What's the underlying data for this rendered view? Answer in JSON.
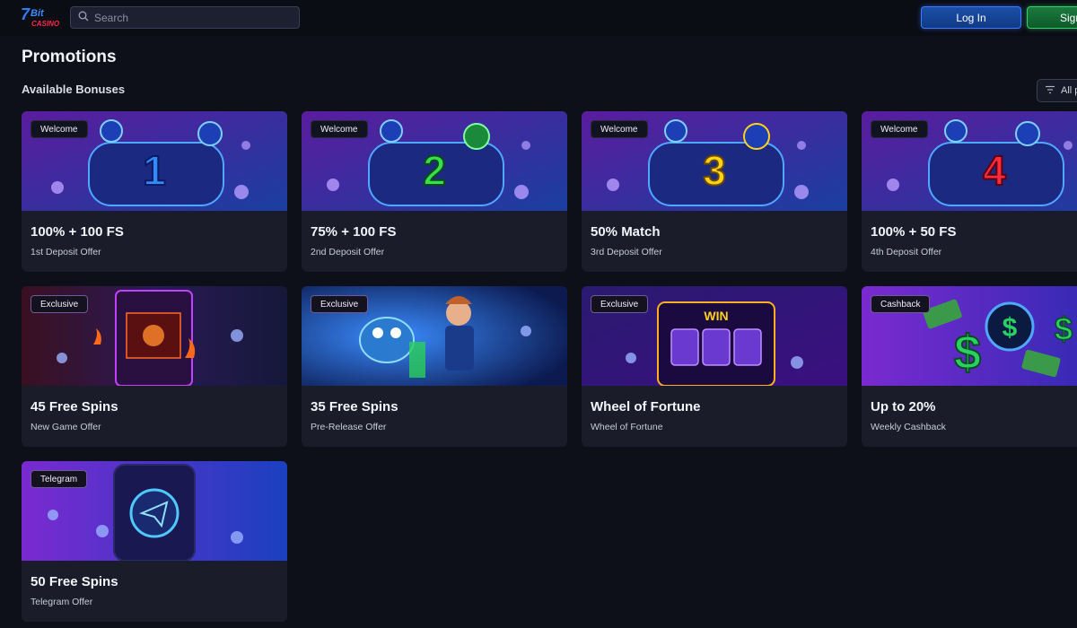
{
  "header": {
    "logo_text": "7Bit Casino",
    "search_placeholder": "Search",
    "login_label": "Log In",
    "signup_label": "Sign"
  },
  "page": {
    "title": "Promotions",
    "section": "Available Bonuses",
    "filter_label": "All p"
  },
  "cards": [
    {
      "badge": "Welcome",
      "title": "100% + 100 FS",
      "subtitle": "1st Deposit Offer",
      "digit": "1",
      "digit_color": "#2f8bff"
    },
    {
      "badge": "Welcome",
      "title": "75% + 100 FS",
      "subtitle": "2nd Deposit Offer",
      "digit": "2",
      "digit_color": "#35e04a"
    },
    {
      "badge": "Welcome",
      "title": "50% Match",
      "subtitle": "3rd Deposit Offer",
      "digit": "3",
      "digit_color": "#ffd21a"
    },
    {
      "badge": "Welcome",
      "title": "100% + 50 FS",
      "subtitle": "4th Deposit Offer",
      "digit": "4",
      "digit_color": "#ff2a3a"
    },
    {
      "badge": "Exclusive",
      "title": "45 Free Spins",
      "subtitle": "New Game Offer"
    },
    {
      "badge": "Exclusive",
      "title": "35 Free Spins",
      "subtitle": "Pre-Release Offer"
    },
    {
      "badge": "Exclusive",
      "title": "Wheel of Fortune",
      "subtitle": "Wheel of Fortune",
      "banner_text": "WIN"
    },
    {
      "badge": "Cashback",
      "title": "Up to 20%",
      "subtitle": "Weekly Cashback"
    },
    {
      "badge": "Telegram",
      "title": "50 Free Spins",
      "subtitle": "Telegram Offer"
    }
  ],
  "colors": {
    "background": "#0e1019",
    "card": "#1a1d29",
    "login_accent": "#3b7cff",
    "signup_accent": "#2fd46b"
  }
}
